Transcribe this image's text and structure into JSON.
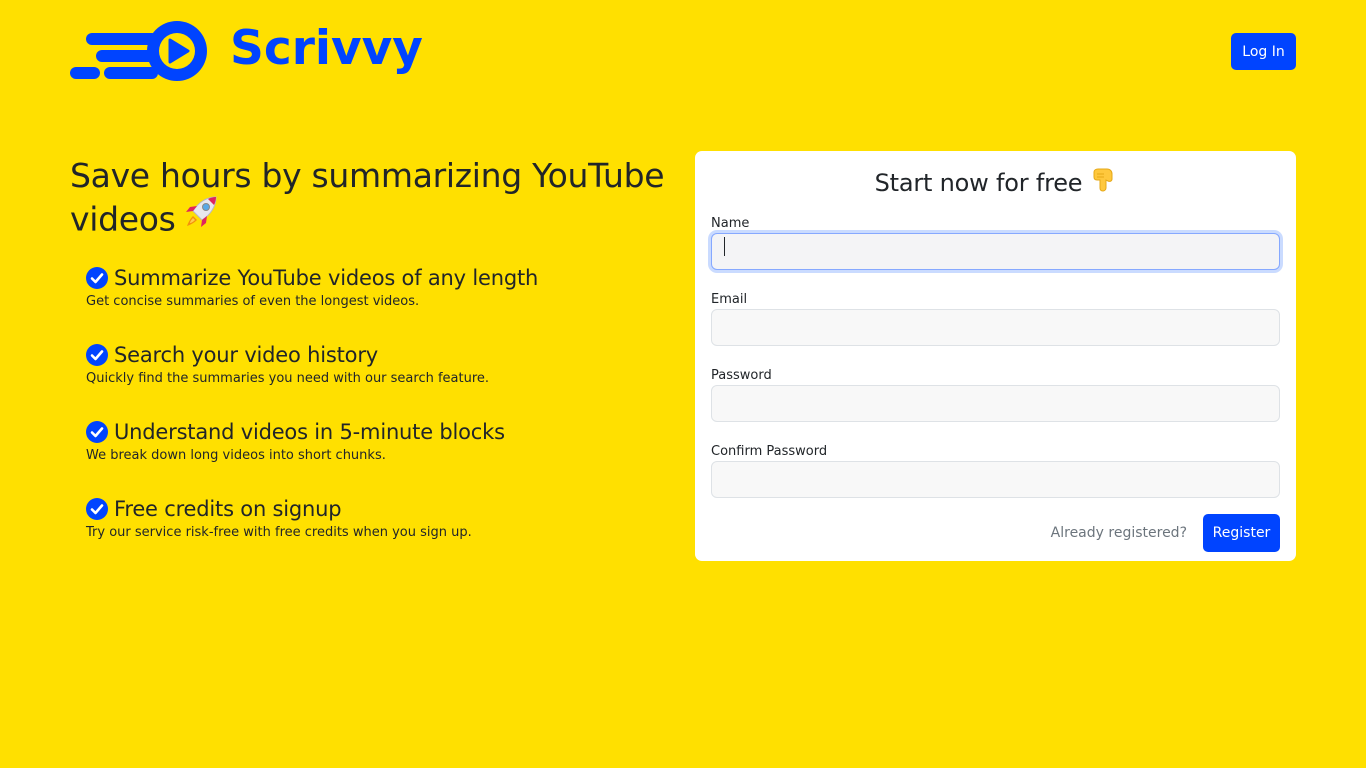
{
  "brand": {
    "name": "Scrivvy",
    "color": "#0044ff",
    "logo_icon": "play-icon"
  },
  "header": {
    "login_label": "Log In"
  },
  "hero": {
    "title": "Save hours by summarizing YouTube videos",
    "title_emoji": "rocket-icon",
    "features": [
      {
        "title": "Summarize YouTube videos of any length",
        "description": "Get concise summaries of even the longest videos."
      },
      {
        "title": "Search your video history",
        "description": "Quickly find the summaries you need with our search feature."
      },
      {
        "title": "Understand videos in 5-minute blocks",
        "description": "We break down long videos into short chunks."
      },
      {
        "title": "Free credits on signup",
        "description": "Try our service risk-free with free credits when you sign up."
      }
    ]
  },
  "form": {
    "title": "Start now for free",
    "title_emoji": "pointing-down-icon",
    "name_label": "Name",
    "name_value": "",
    "email_label": "Email",
    "email_value": "",
    "password_label": "Password",
    "password_value": "",
    "confirm_label": "Confirm Password",
    "confirm_value": "",
    "already_label": "Already registered?",
    "register_label": "Register"
  },
  "colors": {
    "background": "#ffe000",
    "accent": "#0044ff",
    "check": "#0044ff"
  }
}
